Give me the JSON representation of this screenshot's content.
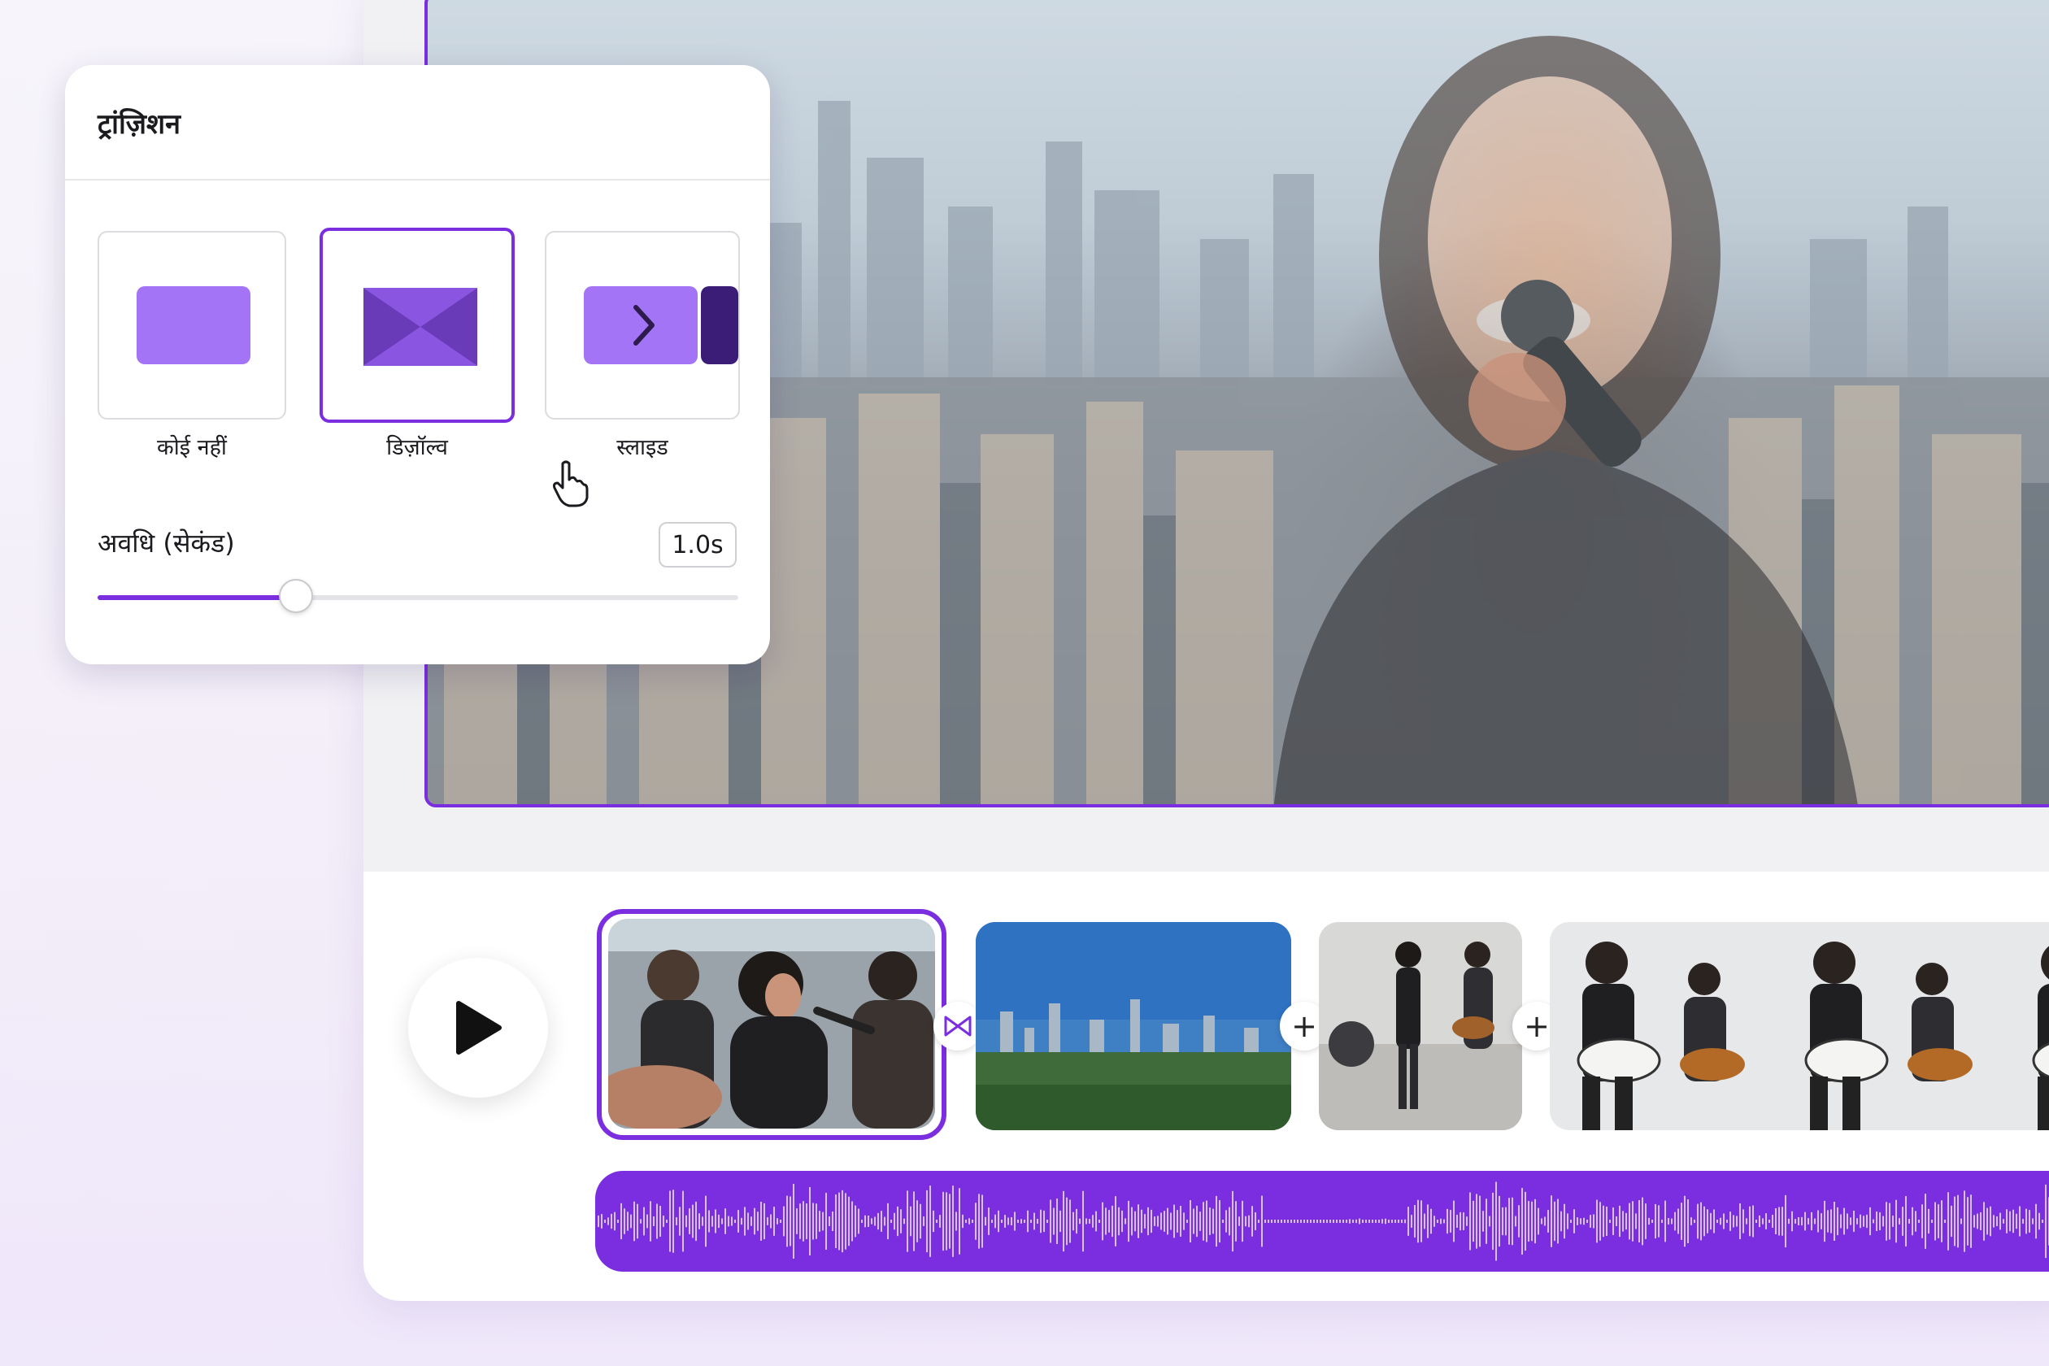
{
  "panel": {
    "title": "ट्रांज़िशन",
    "transitions": [
      {
        "label": "कोई नहीं",
        "icon": "none-transition-icon",
        "selected": false
      },
      {
        "label": "डिज़ॉल्व",
        "icon": "dissolve-transition-icon",
        "selected": true
      },
      {
        "label": "स्लाइड",
        "icon": "slide-transition-icon",
        "selected": false
      }
    ],
    "duration_label": "अवधि (सेकंड)",
    "duration_value": "1.0s",
    "duration_slider_fraction": 0.31
  },
  "preview": {
    "description_icon": "video-preview"
  },
  "timeline": {
    "play_icon": "play-icon",
    "clip_count": 4,
    "selected_clip": 1,
    "transition_node_icon": "bowtie-transition-icon",
    "add_icon": "+",
    "audio_track_icon": "waveform"
  },
  "colors": {
    "accent": "#7b2ee0",
    "accent_light": "#a374f5",
    "accent_dark": "#3b1d78"
  }
}
